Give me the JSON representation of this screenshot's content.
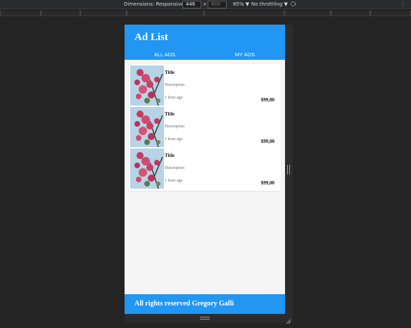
{
  "devtools": {
    "dimensions_label": "Dimensions: Responsive",
    "width_value": "446",
    "times": "×",
    "height_value": "800",
    "zoom": "85%",
    "throttling": "No throttling",
    "dropdown_caret": "▼"
  },
  "app": {
    "title": "Ad List",
    "tabs": [
      {
        "label": "ALL ADS",
        "active": true
      },
      {
        "label": "MY ADS",
        "active": false
      }
    ],
    "ads": [
      {
        "title": "Title",
        "description": "Description",
        "time": "1 hour ago",
        "price": "$99,00"
      },
      {
        "title": "Title",
        "description": "Description",
        "time": "1 hour ago",
        "price": "$99,00"
      },
      {
        "title": "Title",
        "description": "Description",
        "time": "1 hour ago",
        "price": "$99,00"
      }
    ],
    "footer": "All rights reserved Gregory Galli"
  },
  "colors": {
    "primary": "#2196f3",
    "devtools_bg": "#242424"
  }
}
